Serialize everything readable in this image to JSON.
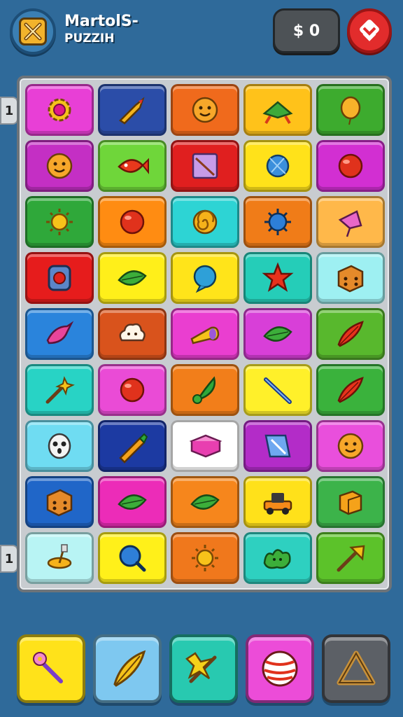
{
  "header": {
    "title": "MartolS-",
    "subtitle": "PUZZIH",
    "coins_label": "$ 0",
    "colors": {
      "menu_icon": "#f2b32c",
      "red_button": "#e22c2c"
    }
  },
  "side_tabs": [
    "1",
    "1"
  ],
  "board": {
    "rows": [
      [
        {
          "color": "#e83fd6",
          "icon": "gear-icon"
        },
        {
          "color": "#2b4da8",
          "icon": "rocket-icon"
        },
        {
          "color": "#f06a1c",
          "icon": "face-icon"
        },
        {
          "color": "#ffc21a",
          "icon": "spaceship-icon"
        },
        {
          "color": "#3dab2e",
          "icon": "balloon-icon"
        }
      ],
      [
        {
          "color": "#c42fc4",
          "icon": "face-icon"
        },
        {
          "color": "#6fd63a",
          "icon": "fish-icon"
        },
        {
          "color": "#e01f1f",
          "icon": "card-icon"
        },
        {
          "color": "#ffe21a",
          "icon": "planet-icon"
        },
        {
          "color": "#d22fd2",
          "icon": "ball-icon"
        }
      ],
      [
        {
          "color": "#2fa83a",
          "icon": "sun-icon"
        },
        {
          "color": "#ff8c12",
          "icon": "ball-icon"
        },
        {
          "color": "#2dd4d4",
          "icon": "swirl-icon"
        },
        {
          "color": "#f07c18",
          "icon": "spiky-ball-icon"
        },
        {
          "color": "#ffb84a",
          "icon": "kite-icon"
        }
      ],
      [
        {
          "color": "#e61c1c",
          "icon": "button-icon"
        },
        {
          "color": "#ffef1a",
          "icon": "leaf-icon"
        },
        {
          "color": "#ffe41a",
          "icon": "bubble-icon"
        },
        {
          "color": "#25cdb8",
          "icon": "star-icon"
        },
        {
          "color": "#9ef0f2",
          "icon": "dice-icon"
        }
      ],
      [
        {
          "color": "#2a84dc",
          "icon": "bird-icon"
        },
        {
          "color": "#d9531c",
          "icon": "cloud-icon"
        },
        {
          "color": "#ea3ed0",
          "icon": "horn-icon"
        },
        {
          "color": "#d83fd8",
          "icon": "leaf-icon"
        },
        {
          "color": "#58b82d",
          "icon": "feather-icon"
        }
      ],
      [
        {
          "color": "#28d3c5",
          "icon": "wand-icon"
        },
        {
          "color": "#ea4bd6",
          "icon": "ball-icon"
        },
        {
          "color": "#f27e1a",
          "icon": "plant-icon"
        },
        {
          "color": "#fff02a",
          "icon": "stick-icon"
        },
        {
          "color": "#3ab23c",
          "icon": "feather-icon"
        }
      ],
      [
        {
          "color": "#6fdcf2",
          "icon": "mask-icon"
        },
        {
          "color": "#1c3aa2",
          "icon": "pencil-icon"
        },
        {
          "color": "#ffffff",
          "icon": "book-icon"
        },
        {
          "color": "#b32cc8",
          "icon": "note-icon"
        },
        {
          "color": "#e94fdc",
          "icon": "face-icon"
        }
      ],
      [
        {
          "color": "#2066c8",
          "icon": "dice-icon"
        },
        {
          "color": "#ec2cb8",
          "icon": "leaf-icon"
        },
        {
          "color": "#f6861c",
          "icon": "leaf-icon"
        },
        {
          "color": "#ffe11a",
          "icon": "car-icon"
        },
        {
          "color": "#3cb34a",
          "icon": "box-icon"
        }
      ],
      [
        {
          "color": "#b8f4f4",
          "icon": "spinner-icon"
        },
        {
          "color": "#fff01a",
          "icon": "magnifier-icon"
        },
        {
          "color": "#f0781c",
          "icon": "sun-icon"
        },
        {
          "color": "#2ed0c0",
          "icon": "blob-icon"
        },
        {
          "color": "#5cc22a",
          "icon": "arrow-icon"
        }
      ]
    ]
  },
  "powerups": [
    {
      "color": "#ffe21a",
      "icon": "flower-wand-icon"
    },
    {
      "color": "#7ec8f0",
      "icon": "feather-icon"
    },
    {
      "color": "#28c9b0",
      "icon": "star-wand-icon"
    },
    {
      "color": "#ec4cd8",
      "icon": "striped-ball-icon"
    },
    {
      "color": "#5c6066",
      "icon": "triangle-icon"
    }
  ]
}
